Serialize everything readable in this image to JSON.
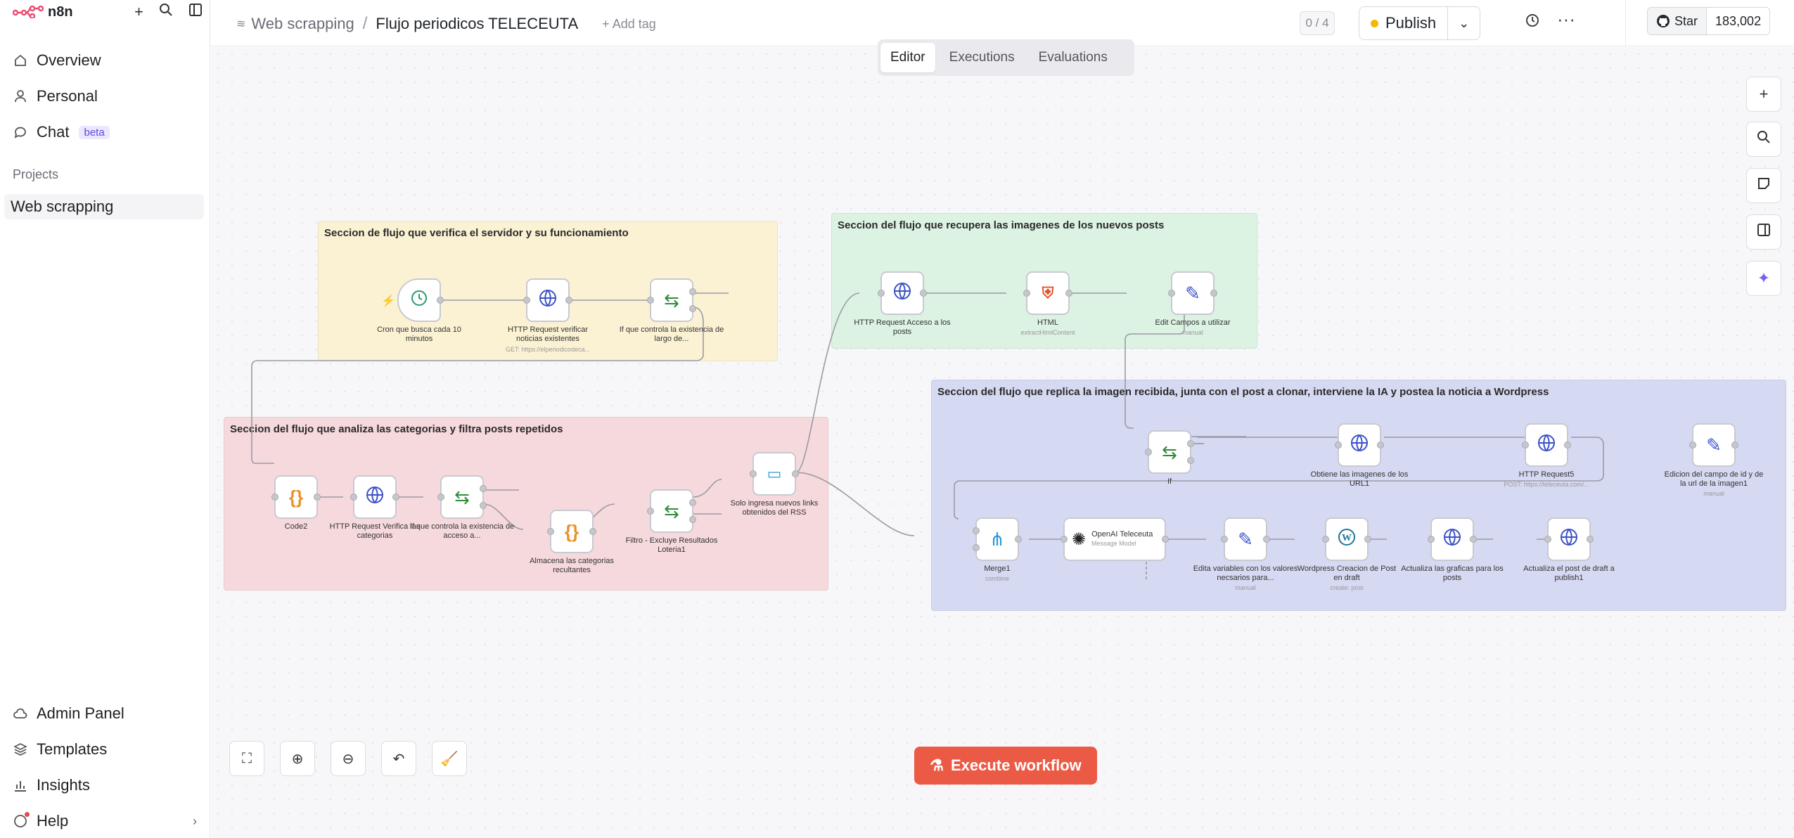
{
  "sidebar": {
    "logo": "n8n",
    "items": {
      "overview": "Overview",
      "personal": "Personal",
      "chat": "Chat",
      "chat_badge": "beta"
    },
    "projects_heading": "Projects",
    "project": "Web scrapping",
    "bottom": {
      "admin": "Admin Panel",
      "templates": "Templates",
      "insights": "Insights",
      "help": "Help"
    }
  },
  "header": {
    "project": "Web scrapping",
    "workflow": "Flujo periodicos TELECEUTA",
    "add_tag": "+ Add tag",
    "counter": "0 / 4",
    "publish": "Publish",
    "star": "Star",
    "stars": "183,002"
  },
  "tabs": {
    "editor": "Editor",
    "executions": "Executions",
    "evaluations": "Evaluations"
  },
  "execute": "Execute workflow",
  "sections": {
    "yellow": "Seccion de flujo que verifica el servidor y su funcionamiento",
    "green": "Seccion del flujo que recupera las imagenes de los nuevos posts",
    "red": "Seccion del flujo que analiza las categorias y filtra posts repetidos",
    "blue": "Seccion del flujo que replica la imagen recibida, junta con el post a clonar, interviene la IA y postea la noticia a Wordpress"
  },
  "nodes": {
    "cron": "Cron que busca cada 10 minutos",
    "http1": "HTTP Request verificar noticias existentes",
    "http1_sub": "GET: https://elperiodicodeca...",
    "if1": "If que controla la existencia de largo de...",
    "http_acc": "HTTP Request Acceso a los posts",
    "html": "HTML",
    "html_sub": "extractHtmlContent",
    "edit1": "Edit Campos a utilizar",
    "edit1_sub": "manual",
    "code2": "Code2",
    "http_cat": "HTTP Request Verifica las categorias",
    "if_cat": "If que controla la existencia de acceso a...",
    "almacena": "Almacena las categorias recultantes",
    "filtro": "Filtro - Excluye Resultados Loteria1",
    "solo": "Solo ingresa nuevos links obtenidos del RSS",
    "if2": "If",
    "obtiene": "Obtiene las imagenes de los URL1",
    "http5": "HTTP Request5",
    "http5_sub": "POST: https://teleceuta.com/...",
    "edicion": "Edicion del campo de id y de la url de la imagen1",
    "edicion_sub": "manual",
    "merge": "Merge1",
    "merge_sub": "combine",
    "openai": "OpenAI Teleceuta",
    "openai_sub": "Message Model",
    "edita": "Edita variables con los valores necsarios para...",
    "edita_sub": "manual",
    "wp": "Wordpress Creacion de Post en draft",
    "wp_sub": "create: post",
    "graficas": "Actualiza las graficas para los posts",
    "publish1": "Actualiza el post de draft a publish1"
  },
  "colors": {
    "yellow": "#fbf2d4",
    "green": "#dcf2e2",
    "red": "#f6d9dc",
    "blue": "#d6d9f2",
    "accent": "#eb5a45",
    "http": "#3d52c8",
    "code": "#e8922b",
    "if": "#2e8b3a",
    "html": "#e34c26"
  }
}
